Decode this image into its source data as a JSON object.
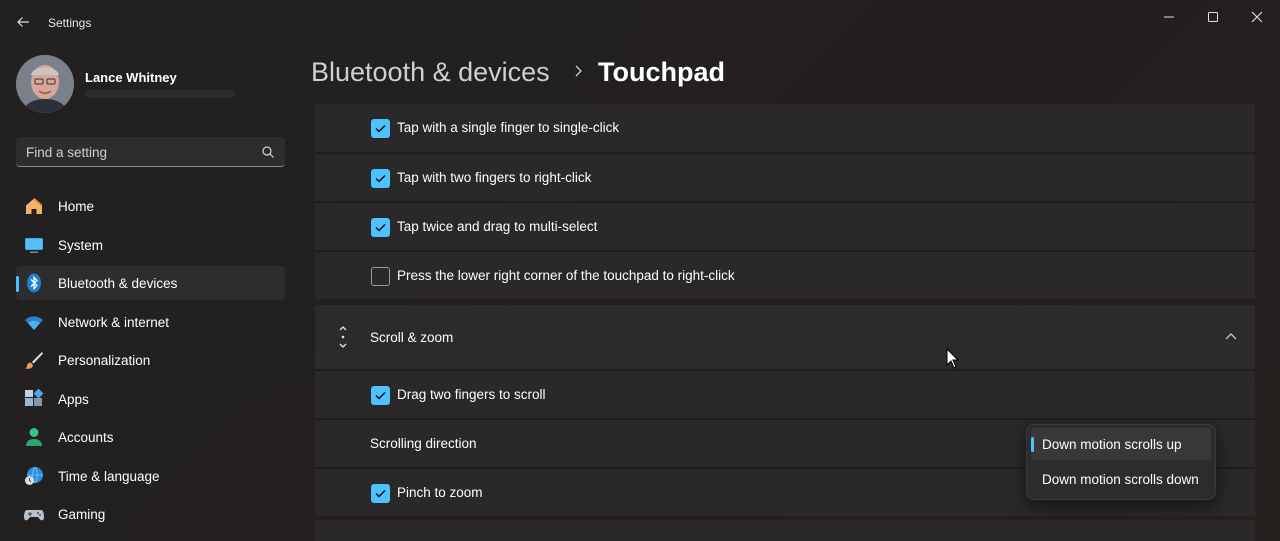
{
  "app": {
    "title": "Settings"
  },
  "user": {
    "name": "Lance Whitney"
  },
  "search": {
    "placeholder": "Find a setting"
  },
  "nav": [
    {
      "label": "Home",
      "icon": "home-icon"
    },
    {
      "label": "System",
      "icon": "monitor-icon"
    },
    {
      "label": "Bluetooth & devices",
      "icon": "bluetooth-icon",
      "active": true
    },
    {
      "label": "Network & internet",
      "icon": "wifi-icon"
    },
    {
      "label": "Personalization",
      "icon": "brush-icon"
    },
    {
      "label": "Apps",
      "icon": "apps-icon"
    },
    {
      "label": "Accounts",
      "icon": "person-icon"
    },
    {
      "label": "Time & language",
      "icon": "globe-clock-icon"
    },
    {
      "label": "Gaming",
      "icon": "gamepad-icon"
    }
  ],
  "breadcrumb": {
    "parent": "Bluetooth & devices",
    "current": "Touchpad"
  },
  "taps": [
    {
      "label": "Tap with a single finger to single-click",
      "checked": true
    },
    {
      "label": "Tap with two fingers to right-click",
      "checked": true
    },
    {
      "label": "Tap twice and drag to multi-select",
      "checked": true
    },
    {
      "label": "Press the lower right corner of the touchpad to right-click",
      "checked": false
    }
  ],
  "scroll_zoom": {
    "title": "Scroll & zoom",
    "drag_scroll": {
      "label": "Drag two fingers to scroll",
      "checked": true
    },
    "direction_label": "Scrolling direction",
    "pinch": {
      "label": "Pinch to zoom",
      "checked": true
    },
    "options": [
      "Down motion scrolls up",
      "Down motion scrolls down"
    ],
    "selected_option": "Down motion scrolls up"
  },
  "colors": {
    "accent": "#4cc2ff",
    "background": "#202020",
    "card": "#2a2828"
  }
}
